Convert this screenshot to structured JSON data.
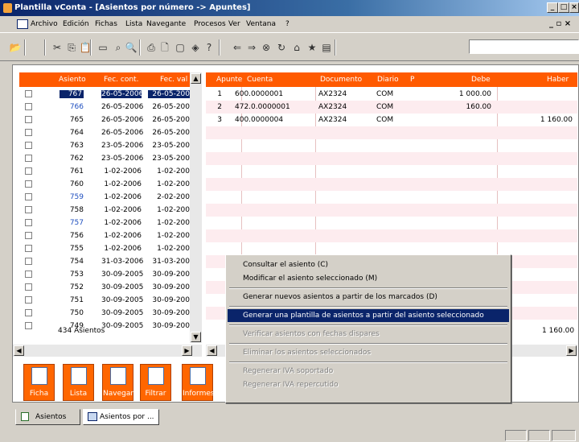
{
  "window": {
    "title": "Plantilla vConta - [Asientos por número -> Apuntes]"
  },
  "menu": [
    "Archivo",
    "Edición",
    "Fichas",
    "Lista",
    "Navegante",
    "Procesos",
    "Ver",
    "Ventana",
    "?"
  ],
  "left_table": {
    "headers": [
      "Asiento",
      "Fec. cont.",
      "Fec. val"
    ],
    "rows": [
      {
        "asiento": "767",
        "fec_cont": "26-05-2006",
        "fec_val": "26-05-200",
        "sel": true
      },
      {
        "asiento": "766",
        "fec_cont": "26-05-2006",
        "fec_val": "26-05-200",
        "blue": true
      },
      {
        "asiento": "765",
        "fec_cont": "26-05-2006",
        "fec_val": "26-05-200"
      },
      {
        "asiento": "764",
        "fec_cont": "26-05-2006",
        "fec_val": "26-05-200"
      },
      {
        "asiento": "763",
        "fec_cont": "23-05-2006",
        "fec_val": "23-05-200"
      },
      {
        "asiento": "762",
        "fec_cont": "23-05-2006",
        "fec_val": "23-05-200"
      },
      {
        "asiento": "761",
        "fec_cont": "1-02-2006",
        "fec_val": "1-02-200"
      },
      {
        "asiento": "760",
        "fec_cont": "1-02-2006",
        "fec_val": "1-02-200"
      },
      {
        "asiento": "759",
        "fec_cont": "1-02-2006",
        "fec_val": "2-02-200",
        "blue": true
      },
      {
        "asiento": "758",
        "fec_cont": "1-02-2006",
        "fec_val": "1-02-200"
      },
      {
        "asiento": "757",
        "fec_cont": "1-02-2006",
        "fec_val": "1-02-200",
        "blue": true
      },
      {
        "asiento": "756",
        "fec_cont": "1-02-2006",
        "fec_val": "1-02-200"
      },
      {
        "asiento": "755",
        "fec_cont": "1-02-2006",
        "fec_val": "1-02-200"
      },
      {
        "asiento": "754",
        "fec_cont": "31-03-2006",
        "fec_val": "31-03-200"
      },
      {
        "asiento": "753",
        "fec_cont": "30-09-2005",
        "fec_val": "30-09-200"
      },
      {
        "asiento": "752",
        "fec_cont": "30-09-2005",
        "fec_val": "30-09-200"
      },
      {
        "asiento": "751",
        "fec_cont": "30-09-2005",
        "fec_val": "30-09-200"
      },
      {
        "asiento": "750",
        "fec_cont": "30-09-2005",
        "fec_val": "30-09-200"
      },
      {
        "asiento": "749",
        "fec_cont": "30-09-2005",
        "fec_val": "30-09-200"
      }
    ],
    "total_count": "434",
    "total_label": "Asientos"
  },
  "right_table": {
    "headers": [
      "Apunte",
      "Cuenta",
      "Documento",
      "Diario",
      "P",
      "Debe",
      "Haber"
    ],
    "rows": [
      {
        "apunte": "1",
        "cuenta": "600.0000001",
        "documento": "AX2324",
        "diario": "COM",
        "debe": "1 000.00",
        "haber": ""
      },
      {
        "apunte": "2",
        "cuenta": "472.0.0000001",
        "documento": "AX2324",
        "diario": "COM",
        "debe": "160.00",
        "haber": ""
      },
      {
        "apunte": "3",
        "cuenta": "400.0000004",
        "documento": "AX2324",
        "diario": "COM",
        "debe": "",
        "haber": "1 160.00"
      }
    ],
    "total_haber": "1 160.00"
  },
  "context_menu": [
    {
      "label": "Consultar el asiento (C)",
      "state": "normal"
    },
    {
      "label": "Modificar el asiento seleccionado (M)",
      "state": "normal"
    },
    {
      "sep": true
    },
    {
      "label": "Generar nuevos asientos a partir de los marcados (D)",
      "state": "normal"
    },
    {
      "sep": true
    },
    {
      "label": "Generar una plantilla de asientos a partir del asiento seleccionado",
      "state": "selected"
    },
    {
      "sep": true
    },
    {
      "label": "Verificar asientos con fechas dispares",
      "state": "disabled"
    },
    {
      "sep": true
    },
    {
      "label": "Eliminar los asientos seleccionados",
      "state": "disabled"
    },
    {
      "sep": true
    },
    {
      "label": "Regenerar IVA soportado",
      "state": "disabled"
    },
    {
      "label": "Regenerar IVA repercutido",
      "state": "disabled"
    }
  ],
  "action_buttons": [
    {
      "label": "Ficha",
      "icon": "ficha-icon"
    },
    {
      "label": "Lista",
      "icon": "lista-icon"
    },
    {
      "label": "Navegar",
      "icon": "navegar-icon"
    },
    {
      "label": "Filtrar",
      "icon": "filtrar-icon"
    },
    {
      "label": "Informes",
      "icon": "informes-icon"
    }
  ],
  "window_tabs": [
    "Asientos",
    "Asientos por ..."
  ],
  "colors": {
    "header": "#ff5a00",
    "selection": "#0a246a",
    "link_blue": "#1f4fbf",
    "pink_row": "#fdecef"
  }
}
